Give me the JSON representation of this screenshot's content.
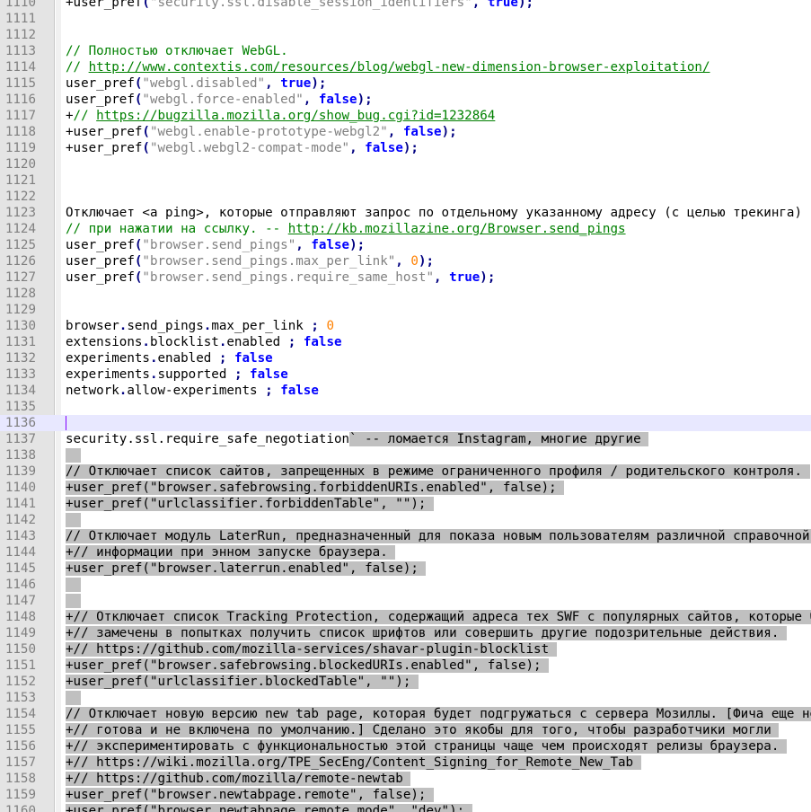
{
  "editor": {
    "lines": [
      {
        "n": "1110",
        "t": "+user_pref(\"security.ssl.disable_session_identifiers\", true);"
      },
      {
        "n": "1111",
        "t": ""
      },
      {
        "n": "1112",
        "t": ""
      },
      {
        "n": "1113",
        "t": "// Полностью отключает WebGL."
      },
      {
        "n": "1114",
        "t": "// http://www.contextis.com/resources/blog/webgl-new-dimension-browser-exploitation/"
      },
      {
        "n": "1115",
        "t": "user_pref(\"webgl.disabled\", true);"
      },
      {
        "n": "1116",
        "t": "user_pref(\"webgl.force-enabled\", false);"
      },
      {
        "n": "1117",
        "t": "+// https://bugzilla.mozilla.org/show_bug.cgi?id=1232864"
      },
      {
        "n": "1118",
        "t": "+user_pref(\"webgl.enable-prototype-webgl2\", false);"
      },
      {
        "n": "1119",
        "t": "+user_pref(\"webgl.webgl2-compat-mode\", false);"
      },
      {
        "n": "1120",
        "t": ""
      },
      {
        "n": "1121",
        "t": ""
      },
      {
        "n": "1122",
        "t": ""
      },
      {
        "n": "1123",
        "t": "Отключает <a ping>, которые отправляют запрос по отдельному указанному адресу (с целью трекинга)"
      },
      {
        "n": "1124",
        "t": "// при нажатии на ссылку. -- http://kb.mozillazine.org/Browser.send_pings"
      },
      {
        "n": "1125",
        "t": "user_pref(\"browser.send_pings\", false);"
      },
      {
        "n": "1126",
        "t": "user_pref(\"browser.send_pings.max_per_link\", 0);"
      },
      {
        "n": "1127",
        "t": "user_pref(\"browser.send_pings.require_same_host\", true);"
      },
      {
        "n": "1128",
        "t": ""
      },
      {
        "n": "1129",
        "t": ""
      },
      {
        "n": "1130",
        "t": "browser.send_pings.max_per_link ; 0"
      },
      {
        "n": "1131",
        "t": "extensions.blocklist.enabled ; false"
      },
      {
        "n": "1132",
        "t": "experiments.enabled ; false"
      },
      {
        "n": "1133",
        "t": "experiments.supported ; false"
      },
      {
        "n": "1134",
        "t": "network.allow-experiments ; false"
      },
      {
        "n": "1135",
        "t": ""
      },
      {
        "n": "1136",
        "t": ""
      },
      {
        "n": "1137",
        "t": "security.ssl.require_safe_negotiation` -- ломается Instagram, многие другие"
      },
      {
        "n": "1138",
        "t": ""
      },
      {
        "n": "1139",
        "t": "// Отключает список сайтов, запрещенных в режиме ограниченного профиля / родительского контроля."
      },
      {
        "n": "1140",
        "t": "+user_pref(\"browser.safebrowsing.forbiddenURIs.enabled\", false);"
      },
      {
        "n": "1141",
        "t": "+user_pref(\"urlclassifier.forbiddenTable\", \"\");"
      },
      {
        "n": "1142",
        "t": ""
      },
      {
        "n": "1143",
        "t": "// Отключает модуль LaterRun, предназначенный для показа новым пользователям различной справочной"
      },
      {
        "n": "1144",
        "t": "+// информации при энном запуске браузера."
      },
      {
        "n": "1145",
        "t": "+user_pref(\"browser.laterrun.enabled\", false);"
      },
      {
        "n": "1146",
        "t": ""
      },
      {
        "n": "1147",
        "t": ""
      },
      {
        "n": "1148",
        "t": "+// Отключает список Tracking Protection, содержащий адреса тех SWF с популярных сайтов, которые были"
      },
      {
        "n": "1149",
        "t": "+// замечены в попытках получить список шрифтов или совершить другие подозрительные действия."
      },
      {
        "n": "1150",
        "t": "+// https://github.com/mozilla-services/shavar-plugin-blocklist"
      },
      {
        "n": "1151",
        "t": "+user_pref(\"browser.safebrowsing.blockedURIs.enabled\", false);"
      },
      {
        "n": "1152",
        "t": "+user_pref(\"urlclassifier.blockedTable\", \"\");"
      },
      {
        "n": "1153",
        "t": ""
      },
      {
        "n": "1154",
        "t": "// Отключает новую версию new tab page, которая будет подгружаться с сервера Мозиллы. [Фича еще не"
      },
      {
        "n": "1155",
        "t": "+// готова и не включена по умолчанию.] Сделано это якобы для того, чтобы разработчики могли"
      },
      {
        "n": "1156",
        "t": "+// экспериментировать с функциональностью этой страницы чаще чем происходят релизы браузера."
      },
      {
        "n": "1157",
        "t": "+// https://wiki.mozilla.org/TPE_SecEng/Content_Signing_for_Remote_New_Tab"
      },
      {
        "n": "1158",
        "t": "+// https://github.com/mozilla/remote-newtab"
      },
      {
        "n": "1159",
        "t": "+user_pref(\"browser.newtabpage.remote\", false);"
      },
      {
        "n": "1160",
        "t": "+user_pref(\"browser.newtabpage.remote.mode\", \"dev\");"
      }
    ]
  }
}
